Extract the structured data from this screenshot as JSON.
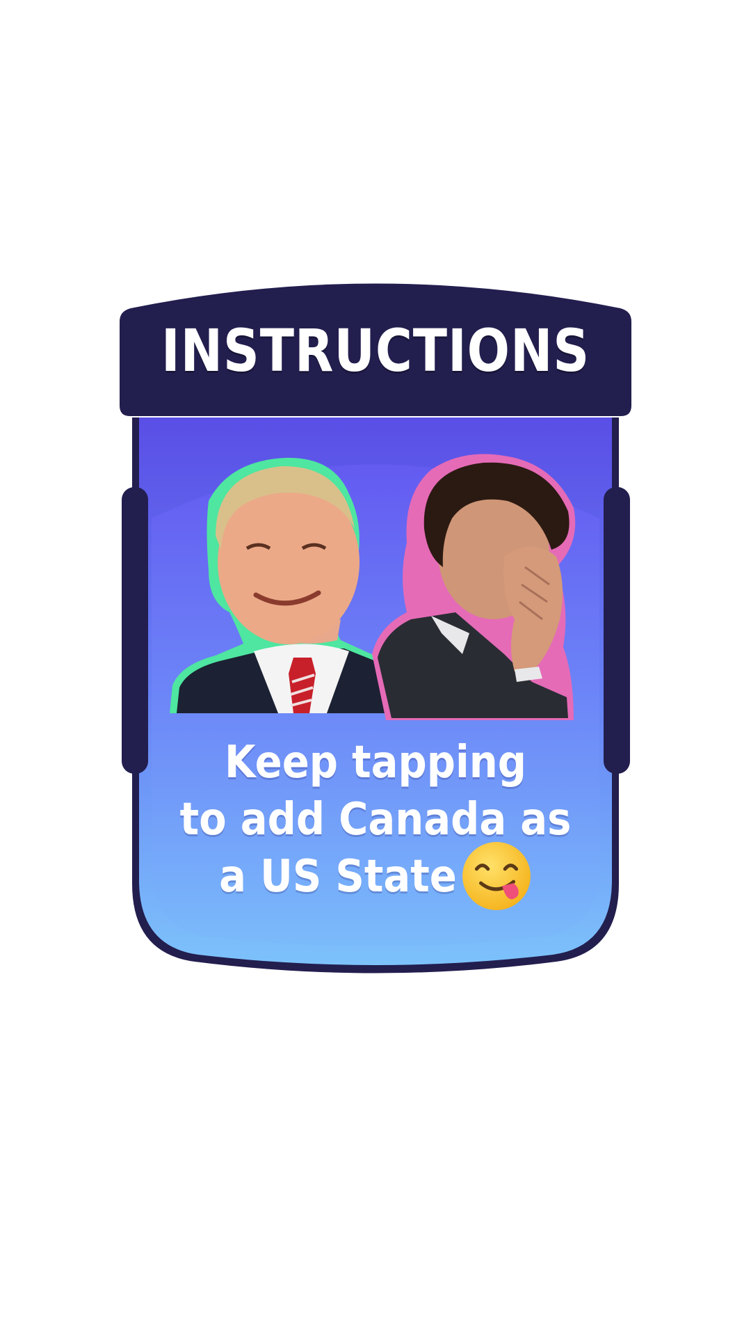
{
  "panel": {
    "title": "INSTRUCTIONS",
    "instruction_lines": [
      "Keep tapping",
      "to add Canada as",
      "a US State"
    ],
    "emoji_icon": "face-savoring-food-emoji"
  },
  "illustrations": {
    "left_figure": "smiling-man-in-suit-red-tie",
    "right_figure": "man-covering-face-with-hand"
  },
  "colors": {
    "frame_dark": "#221e4e",
    "panel_top": "#5a4fe6",
    "panel_bottom": "#7ec0fb",
    "left_outline": "#4ee6a0",
    "right_outline": "#e56bb7",
    "text": "#ffffff"
  }
}
